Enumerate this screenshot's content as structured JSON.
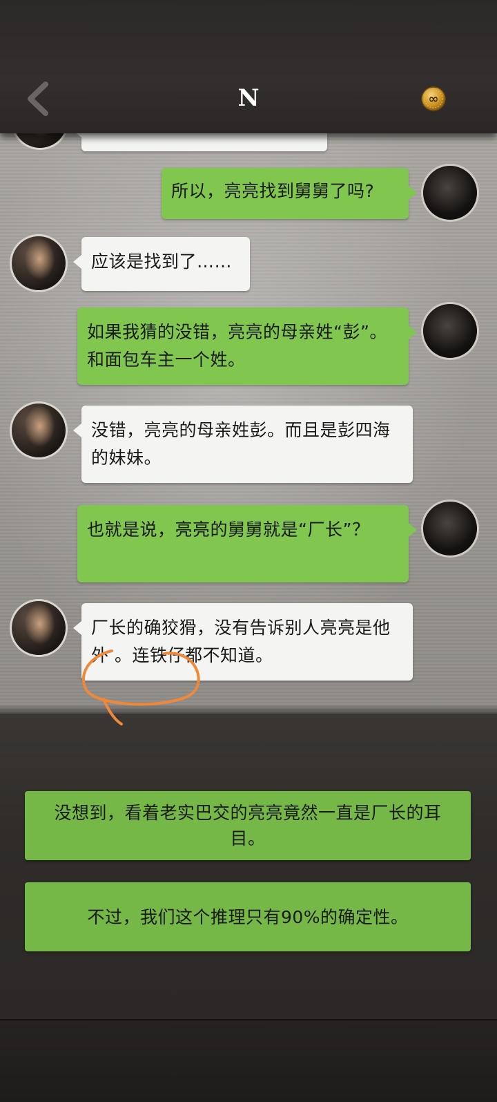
{
  "header": {
    "title": "N",
    "back_icon": "chevron-left-icon",
    "coin_icon": "infinity-coin-icon",
    "coin_symbol": "∞"
  },
  "chat": {
    "messages": [
      {
        "side": "right",
        "text": "所以，亮亮找到舅舅了吗?"
      },
      {
        "side": "left",
        "text": "应该是找到了……"
      },
      {
        "side": "right",
        "text": "如果我猜的没错，亮亮的母亲姓“彭”。和面包车主一个姓。"
      },
      {
        "side": "left",
        "text": "没错，亮亮的母亲姓彭。而且是彭四海的妹妹。"
      },
      {
        "side": "right",
        "text": "也就是说，亮亮的舅舅就是“厂长”？"
      },
      {
        "side": "left",
        "text": "厂长的确狡猾，没有告诉别人亮亮是他外 。连铁仔都不知道。"
      }
    ]
  },
  "options": [
    {
      "text": "没想到，看着老实巴交的亮亮竟然一直是厂长的耳目。"
    },
    {
      "text": "不过，我们这个推理只有90%的确定性。"
    }
  ],
  "colors": {
    "bubble_green": "#80c64f",
    "bubble_white": "#f4f4f2",
    "option_green": "#76b848",
    "annotation_orange": "#f0883a"
  }
}
